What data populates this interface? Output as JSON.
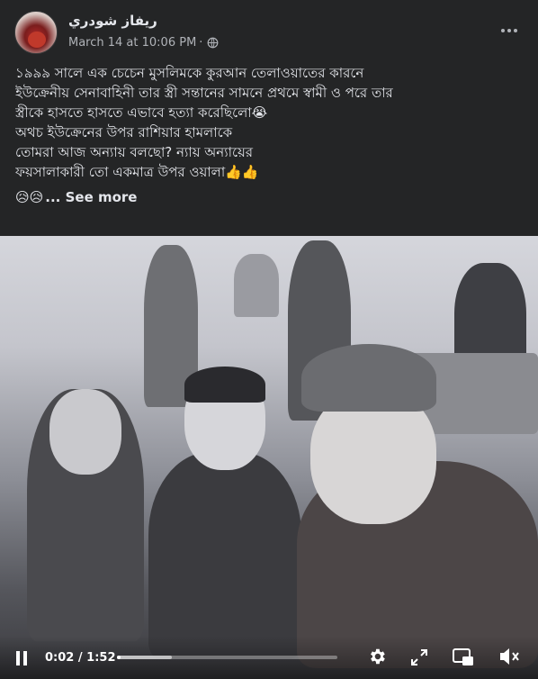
{
  "post": {
    "author": "ريفاز شودري",
    "date": "March 14 at 10:06 PM",
    "separator": "·",
    "visibility_icon": "globe-icon",
    "more_icon": "more-options-icon",
    "text_lines": [
      "১৯৯৯ সালে এক চেচেন মুসলিমকে কুরআন তেলাওয়াতের কারনে",
      "ইউক্রেনীয় সেনাবাহিনী তার স্ত্রী সন্তানের সামনে প্রথমে স্বামী ও পরে তার",
      "স্ত্রীকে হাসতে হাসতে এভাবে হত্যা করেছিলো😭",
      "অথচ ইউক্রেনের উপর রাশিয়ার হামলাকে",
      "তোমরা আজ অন্যায় বলছো? ন্যায় অন্যায়ের",
      "ফয়সালাকারী তো একমাত্র উপর ওয়ালা👍👍"
    ],
    "emoji_prefix": "😥😥",
    "see_more": "... See more"
  },
  "video": {
    "current_time": "0:02",
    "time_separator": " / ",
    "duration": "1:52",
    "progress_fraction": 0.018,
    "buffer_fraction": 0.25,
    "icons": [
      "pause-icon",
      "settings-icon",
      "fullscreen-icon",
      "picture-in-picture-icon",
      "mute-icon"
    ]
  },
  "colors": {
    "background": "#242526",
    "text_primary": "#e4e6eb",
    "text_secondary": "#b0b3b8"
  }
}
